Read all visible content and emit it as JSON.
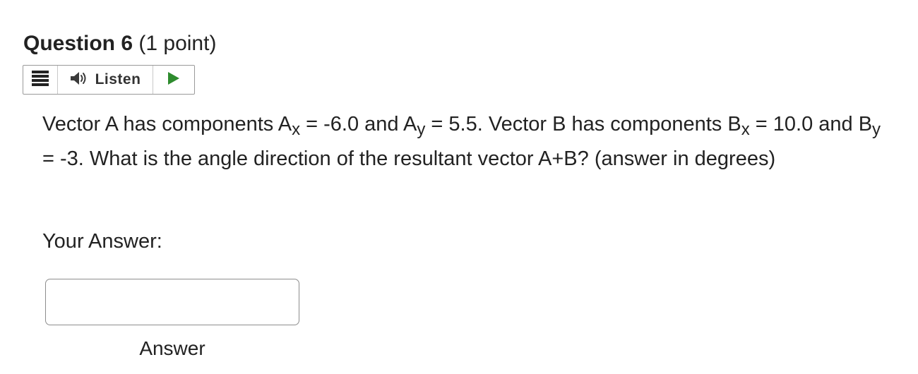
{
  "question": {
    "number_label": "Question 6",
    "points_label": "(1 point)"
  },
  "toolbar": {
    "menu_icon": "hamburger-menu-icon",
    "listen_icon": "speaker-icon",
    "listen_label": "Listen",
    "play_icon": "play-icon",
    "play_color": "#2e8b2e"
  },
  "body": {
    "p1": "Vector A has components A",
    "sub_x1": "x",
    "p2": " = -6.0 and A",
    "sub_y1": "y",
    "p3": " = 5.5. Vector B has components B",
    "sub_x2": "x",
    "p4": " = 10.0 and B",
    "sub_y2": "y",
    "p5": " = -3.  What is the angle direction of the resultant vector A+B? (answer in degrees)"
  },
  "answer": {
    "label": "Your Answer:",
    "value": "",
    "caption": "Answer"
  }
}
